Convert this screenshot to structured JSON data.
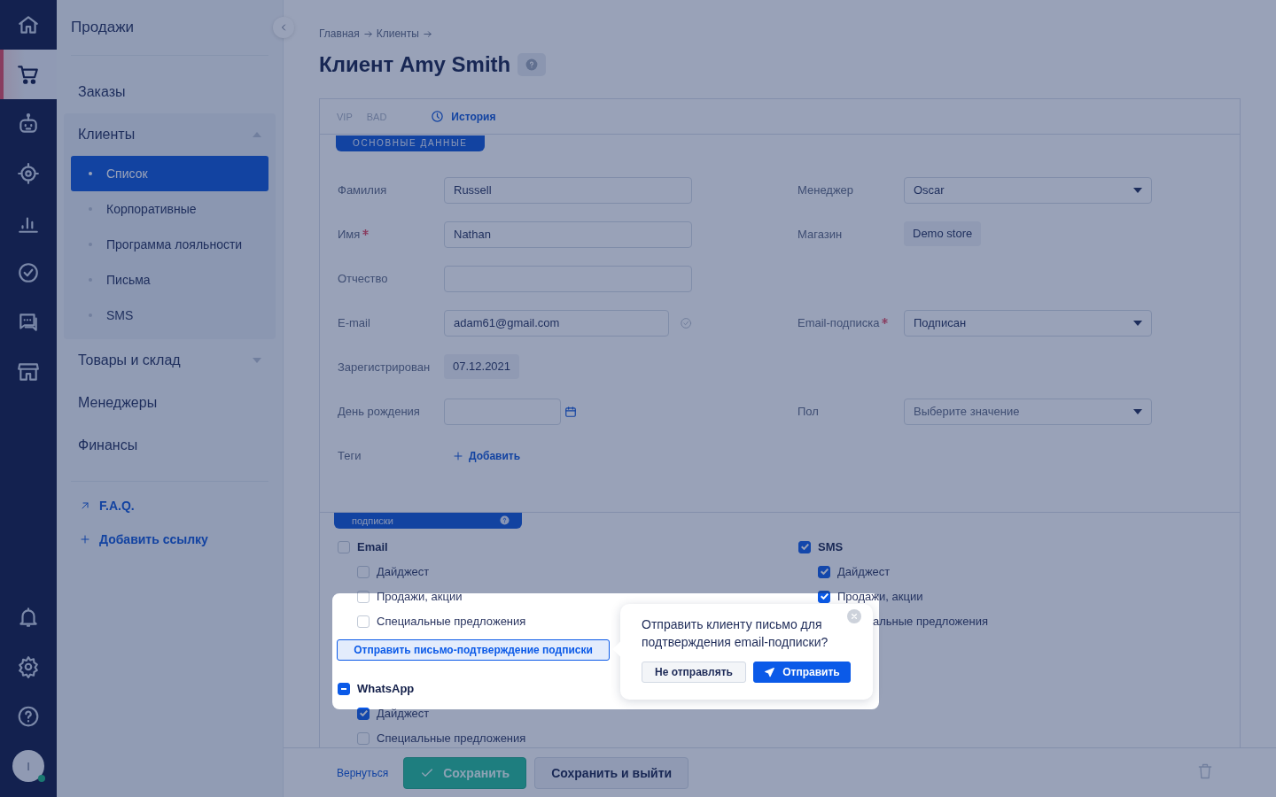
{
  "rail": {
    "top": [
      {
        "kind": "home",
        "selected": false
      },
      {
        "kind": "cart",
        "selected": true
      },
      {
        "kind": "robot",
        "selected": false
      },
      {
        "kind": "target",
        "selected": false
      },
      {
        "kind": "chart",
        "selected": false
      },
      {
        "kind": "check",
        "selected": false
      },
      {
        "kind": "chat",
        "selected": false
      },
      {
        "kind": "store",
        "selected": false
      }
    ],
    "bottom": [
      {
        "kind": "bell",
        "selected": false
      },
      {
        "kind": "gear",
        "selected": false
      },
      {
        "kind": "help",
        "selected": false
      }
    ],
    "avatar": {
      "initial": "I",
      "online": true
    }
  },
  "sidebar": {
    "title": "Продажи",
    "items": [
      {
        "label": "Заказы"
      },
      {
        "label": "Клиенты",
        "expanded": true,
        "children": [
          {
            "label": "Список",
            "selected": true
          },
          {
            "label": "Корпоративные",
            "selected": false
          },
          {
            "label": "Программа лояльности",
            "selected": false
          },
          {
            "label": "Письма",
            "selected": false
          },
          {
            "label": "SMS",
            "selected": false
          }
        ]
      },
      {
        "label": "Товары и склад",
        "expanded": false
      },
      {
        "label": "Менеджеры"
      },
      {
        "label": "Финансы"
      }
    ],
    "links": [
      {
        "kind": "external",
        "label": "F.A.Q."
      },
      {
        "kind": "add",
        "label": "Добавить ссылку"
      }
    ]
  },
  "breadcrumbs": [
    "Главная",
    "Клиенты"
  ],
  "page": {
    "title": "Клиент Amy Smith"
  },
  "card": {
    "tags": [
      "VIP",
      "BAD"
    ],
    "history": "История"
  },
  "main_section": {
    "title": "ОСНОВНЫЕ ДАННЫЕ",
    "rows": [
      {
        "left": {
          "label": "Фамилия",
          "kind": "input",
          "required": false,
          "value": "Russell"
        },
        "right": {
          "label": "Менеджер",
          "kind": "select",
          "required": false,
          "value": "Oscar"
        }
      },
      {
        "left": {
          "label": "Имя",
          "kind": "input",
          "required": true,
          "value": "Nathan"
        },
        "right": {
          "label": "Магазин",
          "kind": "static",
          "required": false,
          "value": "Demo store"
        }
      },
      {
        "left": {
          "label": "Отчество",
          "kind": "input",
          "required": false
        }
      },
      {
        "left": {
          "label": "E-mail",
          "kind": "email",
          "required": false,
          "value": "adam61@gmail.com"
        },
        "right": {
          "label": "Email-подписка",
          "kind": "select",
          "required": true,
          "value": "Подписан"
        }
      },
      {
        "left": {
          "label": "Зарегистрирован",
          "kind": "static",
          "required": false,
          "value": "07.12.2021"
        }
      },
      {
        "left": {
          "label": "День рождения",
          "kind": "date",
          "required": false
        },
        "right": {
          "label": "Пол",
          "kind": "select",
          "required": false,
          "placeholder": "Выберите значение"
        }
      },
      {
        "left": {
          "label": "Теги",
          "kind": "add",
          "required": false,
          "value": "Добавить"
        }
      }
    ]
  },
  "subscriptions": {
    "title": "подписки",
    "left": [
      {
        "kind": "group",
        "label": "Email",
        "checked": false,
        "partial": false,
        "children": [
          {
            "kind": "checkbox",
            "label": "Дайджест",
            "checked": false
          },
          {
            "kind": "checkbox",
            "label": "Продажи, акции",
            "checked": false
          },
          {
            "kind": "checkbox",
            "label": "Специальные предложения",
            "checked": false
          }
        ]
      },
      {
        "kind": "button",
        "label": "Отправить письмо-подтверждение подписки"
      },
      {
        "kind": "group",
        "label": "WhatsApp",
        "checked": false,
        "partial": true,
        "children": [
          {
            "kind": "checkbox",
            "label": "Дайджест",
            "checked": true
          },
          {
            "kind": "checkbox",
            "label": "Специальные предложения",
            "checked": false
          }
        ]
      }
    ],
    "right": [
      {
        "kind": "group",
        "label": "SMS",
        "checked": true,
        "partial": false,
        "children": [
          {
            "kind": "checkbox",
            "label": "Дайджест",
            "checked": true
          },
          {
            "kind": "checkbox",
            "label": "Продажи, акции",
            "checked": true
          },
          {
            "kind": "covered",
            "label": "альные предложения"
          }
        ]
      }
    ]
  },
  "popover": {
    "text": "Отправить клиенту письмо для подтверждения email-подписки?",
    "buttons": [
      {
        "kind": "secondary",
        "label": "Не отправлять"
      },
      {
        "kind": "primary",
        "label": "Отправить"
      }
    ]
  },
  "footer": {
    "back": "Вернуться",
    "buttons": [
      {
        "kind": "success",
        "label": "Сохранить"
      },
      {
        "kind": "secondary",
        "label": "Сохранить и выйти"
      }
    ]
  }
}
